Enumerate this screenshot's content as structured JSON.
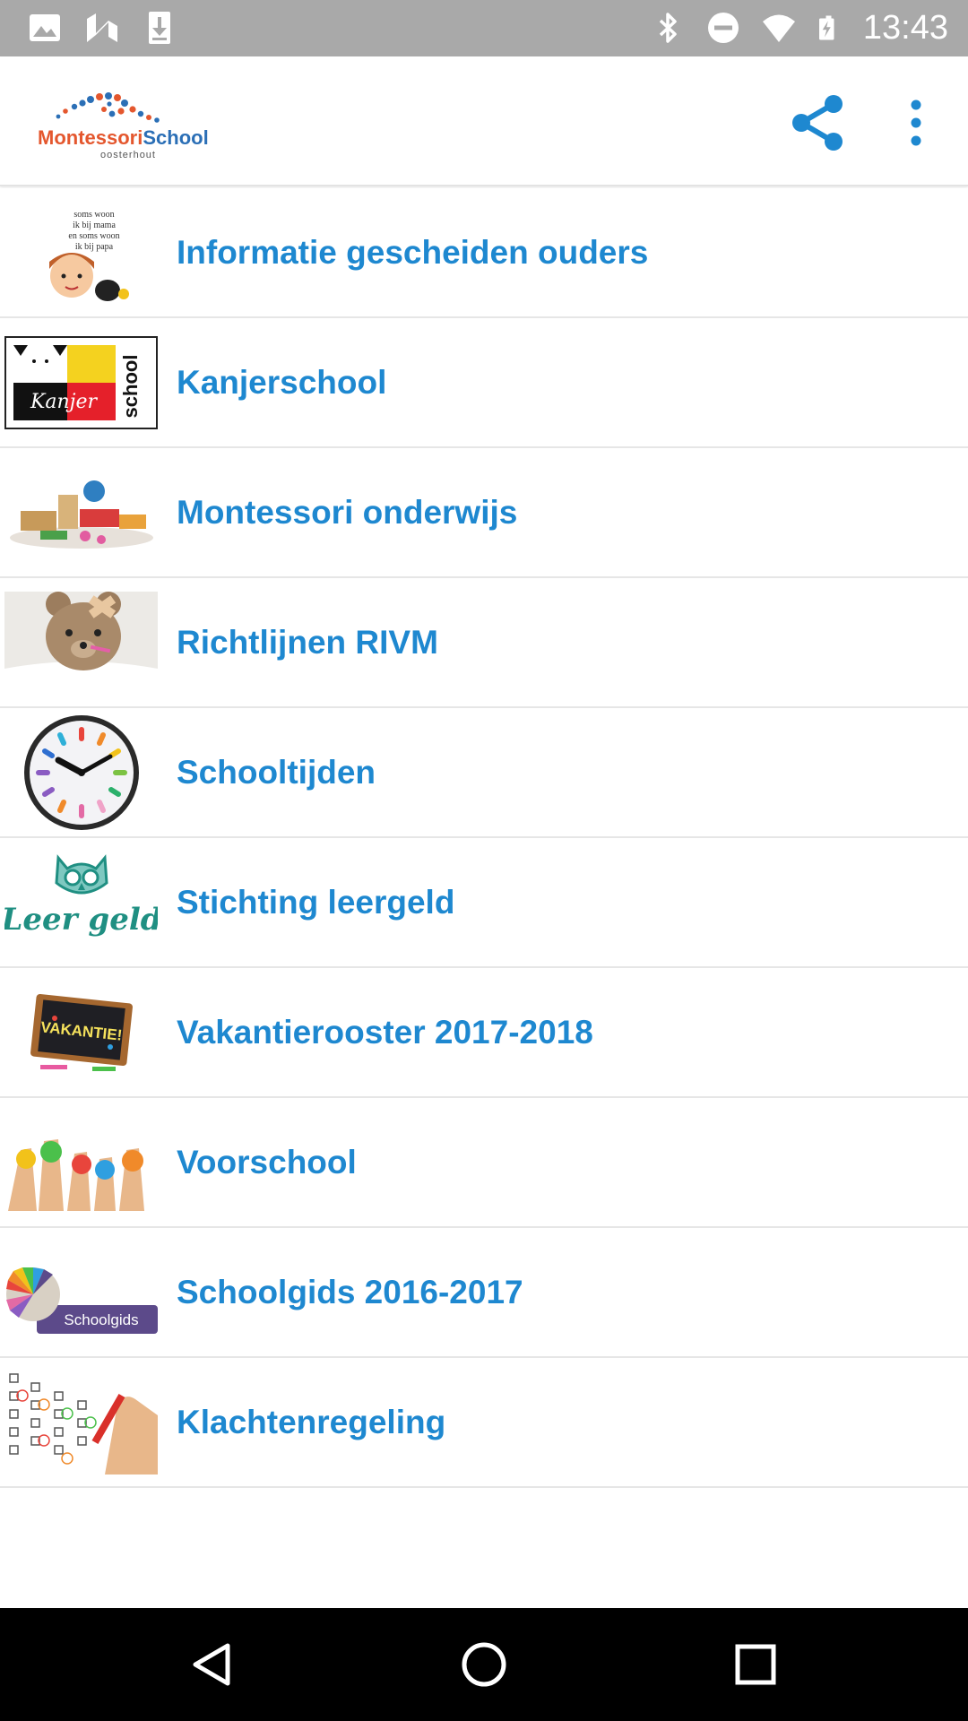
{
  "status_bar": {
    "time": "13:43",
    "left_icons": [
      "image-icon",
      "nfc-icon",
      "download-icon"
    ],
    "right_icons": [
      "bluetooth-icon",
      "do-not-disturb-icon",
      "wifi-icon",
      "battery-icon"
    ]
  },
  "app_bar": {
    "logo": {
      "name": "MontessoriSchool",
      "part1": "Montessori",
      "part2": "School",
      "subtitle": "oosterhout"
    },
    "actions": [
      "share-icon",
      "more-vert-icon"
    ]
  },
  "list": {
    "items": [
      {
        "label": "Informatie gescheiden ouders",
        "thumb": "divorce-book-thumbnail",
        "thumb_text": "soms woon ik bij mama en soms woon ik bij papa"
      },
      {
        "label": "Kanjerschool",
        "thumb": "kanjerschool-logo-thumbnail",
        "thumb_text": "Kanjer school"
      },
      {
        "label": "Montessori onderwijs",
        "thumb": "montessori-materials-thumbnail"
      },
      {
        "label": "Richtlijnen RIVM",
        "thumb": "teddy-bear-thumbnail"
      },
      {
        "label": "Schooltijden",
        "thumb": "clock-thumbnail"
      },
      {
        "label": "Stichting leergeld",
        "thumb": "leergeld-logo-thumbnail",
        "thumb_text": "Leer geld"
      },
      {
        "label": "Vakantierooster 2017-2018",
        "thumb": "vakantie-chalkboard-thumbnail",
        "thumb_text": "VAKANTIE!"
      },
      {
        "label": "Voorschool",
        "thumb": "painted-hands-thumbnail"
      },
      {
        "label": "Schoolgids 2016-2017",
        "thumb": "schoolgids-thumbnail",
        "thumb_text": "Schoolgids"
      },
      {
        "label": "Klachtenregeling",
        "thumb": "smiley-checklist-thumbnail"
      }
    ]
  },
  "nav_bar": {
    "buttons": [
      "back-icon",
      "home-icon",
      "recents-icon"
    ]
  },
  "colors": {
    "status_bar": "#a9a9a9",
    "accent_text": "#1e88d0",
    "share_icon": "#1e88d0",
    "divider": "#e6e6e6",
    "nav_bar": "#000000"
  }
}
